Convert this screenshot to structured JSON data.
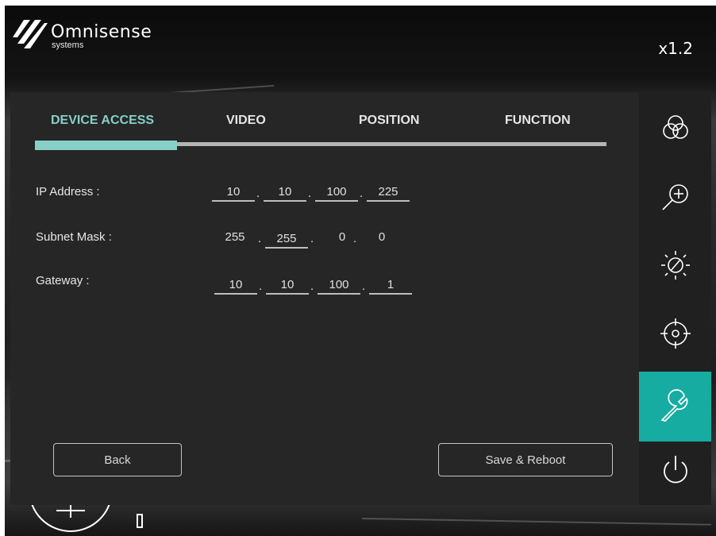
{
  "brand": {
    "name": "Omnisense",
    "sub": "systems"
  },
  "zoom_level": "x1.2",
  "tabs": [
    {
      "label": "DEVICE ACCESS",
      "active": true
    },
    {
      "label": "VIDEO",
      "active": false
    },
    {
      "label": "POSITION",
      "active": false
    },
    {
      "label": "FUNCTION",
      "active": false
    }
  ],
  "tab_progress": 0.25,
  "fields": {
    "ip": {
      "label": "IP Address :",
      "octets": [
        "10",
        "10",
        "100",
        "225"
      ],
      "separator": "."
    },
    "subnet": {
      "label": "Subnet Mask :",
      "octets": [
        "255",
        "255",
        "0",
        "0"
      ],
      "separator": "."
    },
    "gateway": {
      "label": "Gateway :",
      "octets": [
        "10",
        "10",
        "100",
        "1"
      ],
      "separator": "."
    }
  },
  "buttons": {
    "back": "Back",
    "save": "Save & Reboot"
  },
  "side_menu": [
    {
      "icon": "color-circles-icon",
      "active": false
    },
    {
      "icon": "zoom-in-icon",
      "active": false
    },
    {
      "icon": "brightness-icon",
      "active": false
    },
    {
      "icon": "crosshair-target-icon",
      "active": false
    },
    {
      "icon": "wrench-icon",
      "active": true
    },
    {
      "icon": "power-icon",
      "active": false
    }
  ],
  "colors": {
    "accent": "#86d0c8",
    "active_bg": "#16aca2",
    "panel_bg": "#262626"
  }
}
